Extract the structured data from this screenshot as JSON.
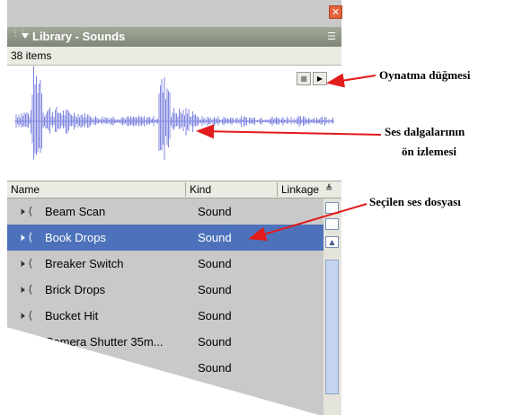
{
  "panel": {
    "title": "Library - Sounds",
    "item_count": "38 items",
    "close_glyph": "✕",
    "menu_glyph": "☰",
    "grip_glyph": "⋮⋮"
  },
  "preview": {
    "stop_glyph": "■",
    "play_glyph": "▶",
    "waveform_color": "#7f86e0"
  },
  "columns": {
    "name": "Name",
    "kind": "Kind",
    "linkage": "Linkage",
    "sort_glyph": "≜"
  },
  "items": [
    {
      "name": "Beam Scan",
      "kind": "Sound",
      "selected": false
    },
    {
      "name": "Book Drops",
      "kind": "Sound",
      "selected": true
    },
    {
      "name": "Breaker Switch",
      "kind": "Sound",
      "selected": false
    },
    {
      "name": "Brick Drops",
      "kind": "Sound",
      "selected": false
    },
    {
      "name": "Bucket Hit",
      "kind": "Sound",
      "selected": false
    },
    {
      "name": "Camera Shutter 35m...",
      "kind": "Sound",
      "selected": false
    },
    {
      "name": "",
      "kind": "Sound",
      "selected": false
    }
  ],
  "icons": {
    "speaker_glyph": "🕨 ⟨"
  },
  "annotations": {
    "play_button": "Oynatma düğmesi",
    "waveform_line1": "Ses dalgalarının",
    "waveform_line2": "ön izlemesi",
    "selected_file": "Seçilen ses dosyası"
  },
  "colors": {
    "selection": "#4d72bb",
    "arrow": "#e21b1b",
    "titlebar": "#8e9585"
  }
}
